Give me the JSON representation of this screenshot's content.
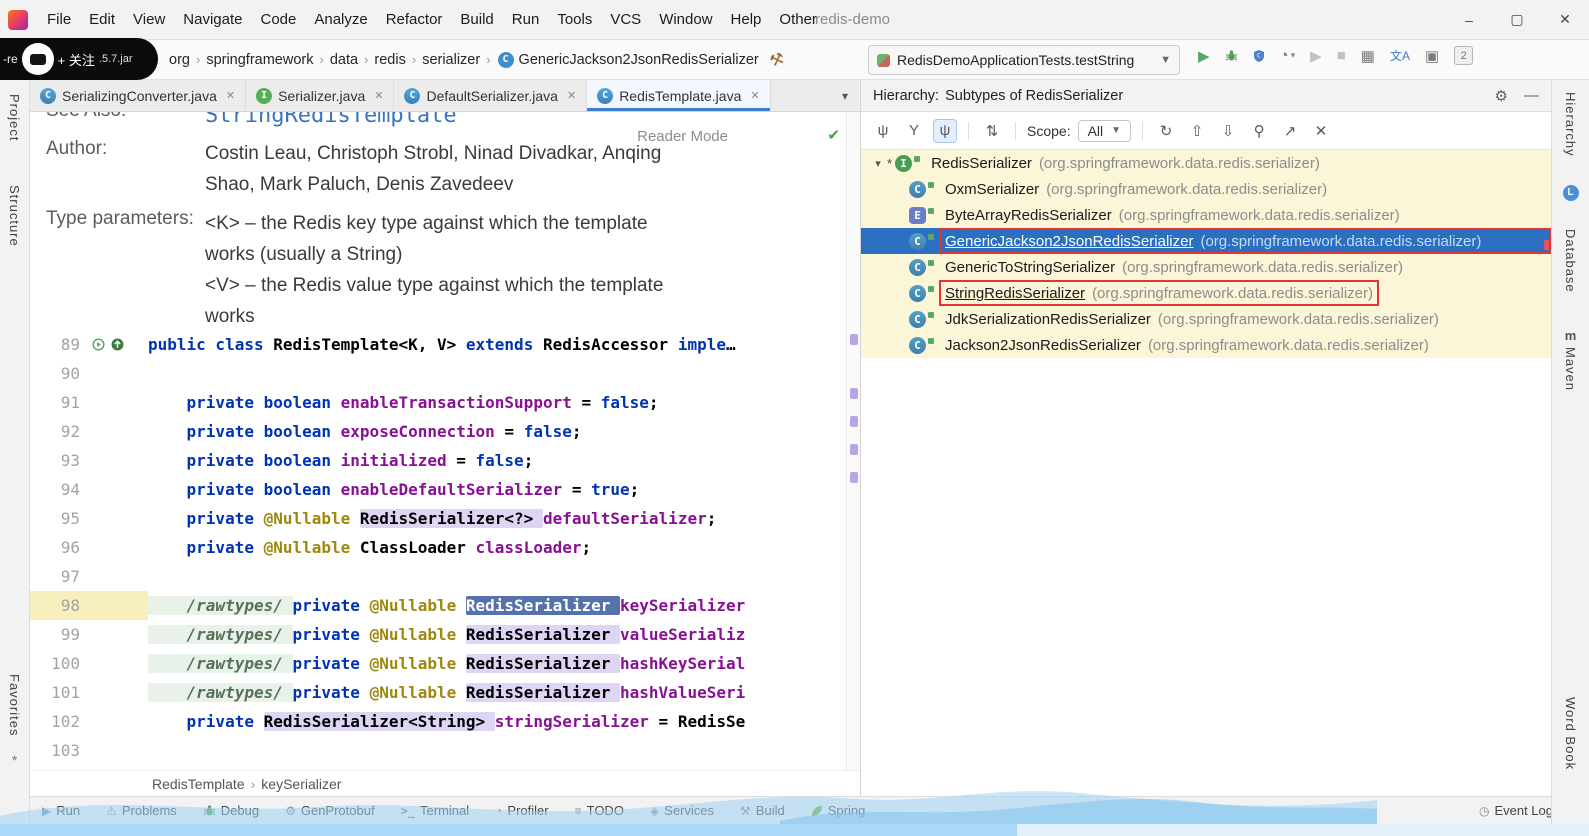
{
  "window": {
    "title": "redis-demo",
    "menu_items": [
      "File",
      "Edit",
      "View",
      "Navigate",
      "Code",
      "Analyze",
      "Refactor",
      "Build",
      "Run",
      "Tools",
      "VCS",
      "Window",
      "Help",
      "Other"
    ]
  },
  "watermark": {
    "left_text": "-re",
    "follow_label": "+ 关注",
    "right_text": ".5.7.jar"
  },
  "navbar": {
    "breadcrumbs": [
      "org",
      "springframework",
      "data",
      "redis",
      "serializer",
      "GenericJackson2JsonRedisSerializer"
    ],
    "run_config": "RedisDemoApplicationTests.testString",
    "run_toolbar_icons": [
      "run-icon",
      "debug-icon",
      "coverage-icon",
      "profiler-icon",
      "rerun-icon",
      "stop-icon",
      "layout-icon",
      "translate-icon",
      "plugin-icon",
      "notifications-icon"
    ]
  },
  "tabs": [
    {
      "label": "SerializingConverter.java",
      "icon": "C"
    },
    {
      "label": "Serializer.java",
      "icon": "I"
    },
    {
      "label": "DefaultSerializer.java",
      "icon": "C"
    },
    {
      "label": "RedisTemplate.java",
      "icon": "C",
      "active": true
    }
  ],
  "editor": {
    "reader_mode_label": "Reader Mode",
    "doc": {
      "see_also_label": "See Also:",
      "see_also_value": "StringRedisTemplate",
      "author_label": "Author:",
      "author_value": "Costin Leau, Christoph Strobl, Ninad Divadkar, Anqing Shao, Mark Paluch, Denis Zavedeev",
      "type_params_label": "Type parameters:",
      "type_param_k": "<K> – the Redis key type against which the template works (usually a String)",
      "type_param_v": "<V> – the Redis value type against which the template works"
    },
    "code_lines": [
      {
        "n": "89",
        "g": [
          "gutter-run-icon",
          "gutter-impl-icon"
        ],
        "t": [
          [
            "kw",
            "public class "
          ],
          [
            "pl",
            "RedisTemplate<K, V> "
          ],
          [
            "kw",
            "extends "
          ],
          [
            "pl",
            "RedisAccessor "
          ],
          [
            "kw",
            "imple"
          ],
          [
            "pl",
            "…"
          ]
        ]
      },
      {
        "n": "90",
        "t": []
      },
      {
        "n": "91",
        "t": [
          [
            "kw",
            "    private boolean "
          ],
          [
            "fi",
            "enableTransactionSupport "
          ],
          [
            "pl",
            "= "
          ],
          [
            "kw",
            "false"
          ],
          [
            "pl",
            ";"
          ]
        ]
      },
      {
        "n": "92",
        "t": [
          [
            "kw",
            "    private boolean "
          ],
          [
            "fi",
            "exposeConnection "
          ],
          [
            "pl",
            "= "
          ],
          [
            "kw",
            "false"
          ],
          [
            "pl",
            ";"
          ]
        ]
      },
      {
        "n": "93",
        "t": [
          [
            "kw",
            "    private boolean "
          ],
          [
            "fi",
            "initialized "
          ],
          [
            "pl",
            "= "
          ],
          [
            "kw",
            "false"
          ],
          [
            "pl",
            ";"
          ]
        ]
      },
      {
        "n": "94",
        "t": [
          [
            "kw",
            "    private boolean "
          ],
          [
            "fi",
            "enableDefaultSerializer "
          ],
          [
            "pl",
            "= "
          ],
          [
            "kw",
            "true"
          ],
          [
            "pl",
            ";"
          ]
        ]
      },
      {
        "n": "95",
        "t": [
          [
            "kw",
            "    private "
          ],
          [
            "an",
            "@Nullable "
          ],
          [
            "lv",
            "RedisSerializer<?> "
          ],
          [
            "fi",
            "defaultSerializer"
          ],
          [
            "pl",
            ";"
          ]
        ]
      },
      {
        "n": "96",
        "t": [
          [
            "kw",
            "    private "
          ],
          [
            "an",
            "@Nullable "
          ],
          [
            "pl",
            "ClassLoader "
          ],
          [
            "fi",
            "classLoader"
          ],
          [
            "pl",
            ";"
          ]
        ]
      },
      {
        "n": "97",
        "t": []
      },
      {
        "n": "98",
        "cur": true,
        "t": [
          [
            "fd",
            "    /rawtypes/ "
          ],
          [
            "kw",
            "private "
          ],
          [
            "an",
            "@Nullable "
          ],
          [
            "sl",
            "RedisSerializer "
          ],
          [
            "fi",
            "keySerializer"
          ]
        ]
      },
      {
        "n": "99",
        "t": [
          [
            "fd",
            "    /rawtypes/ "
          ],
          [
            "kw",
            "private "
          ],
          [
            "an",
            "@Nullable "
          ],
          [
            "lv",
            "RedisSerializer "
          ],
          [
            "fi",
            "valueSerializ"
          ]
        ]
      },
      {
        "n": "100",
        "t": [
          [
            "fd",
            "    /rawtypes/ "
          ],
          [
            "kw",
            "private "
          ],
          [
            "an",
            "@Nullable "
          ],
          [
            "lv",
            "RedisSerializer "
          ],
          [
            "fi",
            "hashKeySerial"
          ]
        ]
      },
      {
        "n": "101",
        "t": [
          [
            "fd",
            "    /rawtypes/ "
          ],
          [
            "kw",
            "private "
          ],
          [
            "an",
            "@Nullable "
          ],
          [
            "lv",
            "RedisSerializer "
          ],
          [
            "fi",
            "hashValueSeri"
          ]
        ]
      },
      {
        "n": "102",
        "t": [
          [
            "kw",
            "    private "
          ],
          [
            "lv",
            "RedisSerializer<String> "
          ],
          [
            "fi",
            "stringSerializer "
          ],
          [
            "pl",
            "= RedisSe"
          ]
        ]
      },
      {
        "n": "103",
        "t": []
      }
    ],
    "breadcrumbs": [
      "RedisTemplate",
      "keySerializer"
    ]
  },
  "hierarchy": {
    "header_title": "Hierarchy:",
    "header_subtitle": "Subtypes of RedisSerializer",
    "scope_label": "Scope:",
    "scope_value": "All",
    "toolbar_left": [
      "class-hierarchy-icon",
      "supertypes-icon",
      "subtypes-icon",
      "sort-alpha-icon"
    ],
    "toolbar_right": [
      "refresh-icon",
      "expand-all-icon",
      "collapse-all-icon",
      "pin-icon",
      "export-icon",
      "close-icon"
    ],
    "tree": [
      {
        "icon": "I",
        "star": true,
        "expanded": true,
        "level": 0,
        "name": "RedisSerializer",
        "pkg": "(org.springframework.data.redis.serializer)"
      },
      {
        "icon": "C",
        "level": 1,
        "name": "OxmSerializer",
        "pkg": "(org.springframework.data.redis.serializer)"
      },
      {
        "icon": "E",
        "level": 1,
        "name": "ByteArrayRedisSerializer",
        "pkg": "(org.springframework.data.redis.serializer)"
      },
      {
        "icon": "C",
        "level": 1,
        "selected": true,
        "red_box": true,
        "name": "GenericJackson2JsonRedisSerializer",
        "pkg": "(org.springframework.data.redis.serializer)"
      },
      {
        "icon": "C",
        "level": 1,
        "name": "GenericToStringSerializer",
        "pkg": "(org.springframework.data.redis.serializer)"
      },
      {
        "icon": "C",
        "level": 1,
        "red_box": true,
        "name": "StringRedisSerializer",
        "pkg": "(org.springframework.data.redis.serializer)"
      },
      {
        "icon": "C",
        "level": 1,
        "name": "JdkSerializationRedisSerializer",
        "pkg": "(org.springframework.data.redis.serializer)"
      },
      {
        "icon": "C",
        "level": 1,
        "name": "Jackson2JsonRedisSerializer",
        "pkg": "(org.springframework.data.redis.serializer)"
      }
    ]
  },
  "left_stripe": [
    "Project",
    "Structure",
    "Favorites"
  ],
  "right_stripe": [
    "Hierarchy",
    "Database",
    "Maven",
    "Word Book"
  ],
  "status_bar": {
    "items": [
      {
        "label": "Run",
        "icon": "status-run"
      },
      {
        "label": "Problems",
        "icon": "status-problems"
      },
      {
        "label": "Debug",
        "icon": "status-debug"
      },
      {
        "label": "GenProtobuf",
        "icon": "status-genprotobuf"
      },
      {
        "label": "Terminal",
        "icon": "status-terminal"
      },
      {
        "label": "Profiler",
        "icon": "status-profiler"
      },
      {
        "label": "TODO",
        "icon": "status-todo"
      },
      {
        "label": "Services",
        "icon": "status-services"
      },
      {
        "label": "Build",
        "icon": "status-build"
      },
      {
        "label": "Spring",
        "icon": "status-spring"
      }
    ],
    "event_log": "Event Log"
  }
}
